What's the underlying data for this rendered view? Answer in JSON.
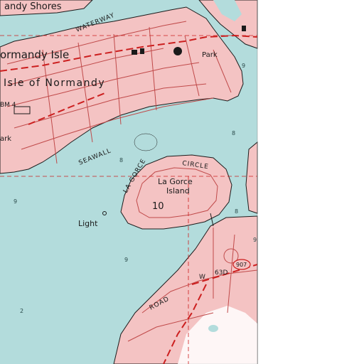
{
  "map": {
    "colors": {
      "water": "#b3dcdc",
      "urban": "#f4c3c3",
      "street": "#c04a4a",
      "highway": "#cc1f1f",
      "shore": "#1c1c1c",
      "outside": "#ffffff"
    },
    "labels": {
      "normandy_shores": "andy Shores",
      "waterway": "WATERWAY",
      "normandy_isle": "ormandy Isle",
      "isle_of_normandy": "Isle of Normandy",
      "park_top": "Park",
      "bm": "BM 4",
      "park_left": "ark",
      "seawall": "SEAWALL",
      "circle": "CIRCLE",
      "la_gorce_road": "LA GORCE",
      "la_gorce_island": "La Gorce",
      "island_word": "Island",
      "section_num": "10",
      "light": "Light",
      "road": "ROAD",
      "route_w": "W",
      "route_num": "63D",
      "shield": "907"
    },
    "depths": {
      "d1": "9",
      "d2": "8",
      "d3": "8",
      "d4": "9",
      "d5": "9",
      "d6": "8",
      "d7": "2",
      "d8": "9"
    }
  }
}
